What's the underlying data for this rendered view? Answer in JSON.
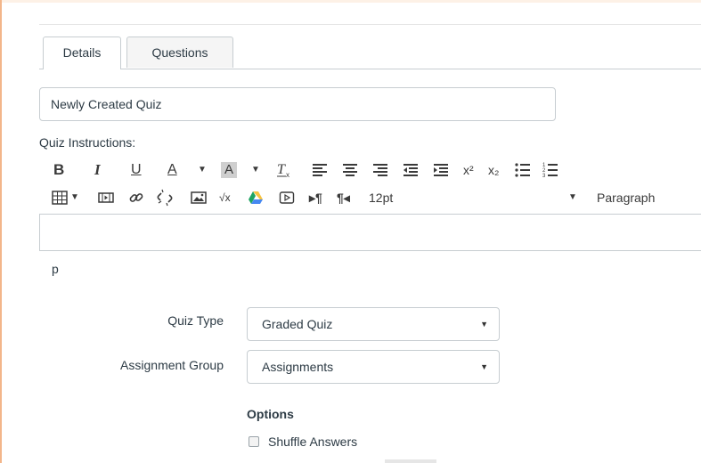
{
  "tabs": [
    {
      "label": "Details"
    },
    {
      "label": "Questions"
    }
  ],
  "quiz_title": {
    "value": "Newly Created Quiz"
  },
  "instructions": {
    "label": "Quiz Instructions:"
  },
  "toolbar": {
    "bold": "B",
    "italic": "I",
    "underline": "U",
    "font_color": "A",
    "bg_color": "A",
    "superscript": "x²",
    "subscript": "x₂",
    "font_size": "12pt",
    "block_format": "Paragraph"
  },
  "editor": {
    "path": "p"
  },
  "fields": {
    "quiz_type": {
      "label": "Quiz Type",
      "value": "Graded Quiz"
    },
    "assignment_group": {
      "label": "Assignment Group",
      "value": "Assignments"
    }
  },
  "options": {
    "title": "Options",
    "shuffle_answers": {
      "label": "Shuffle Answers",
      "checked": false
    }
  },
  "colors": {
    "accent": "#f3b68a",
    "border": "#c7cdd1",
    "text": "#2d3b45"
  }
}
